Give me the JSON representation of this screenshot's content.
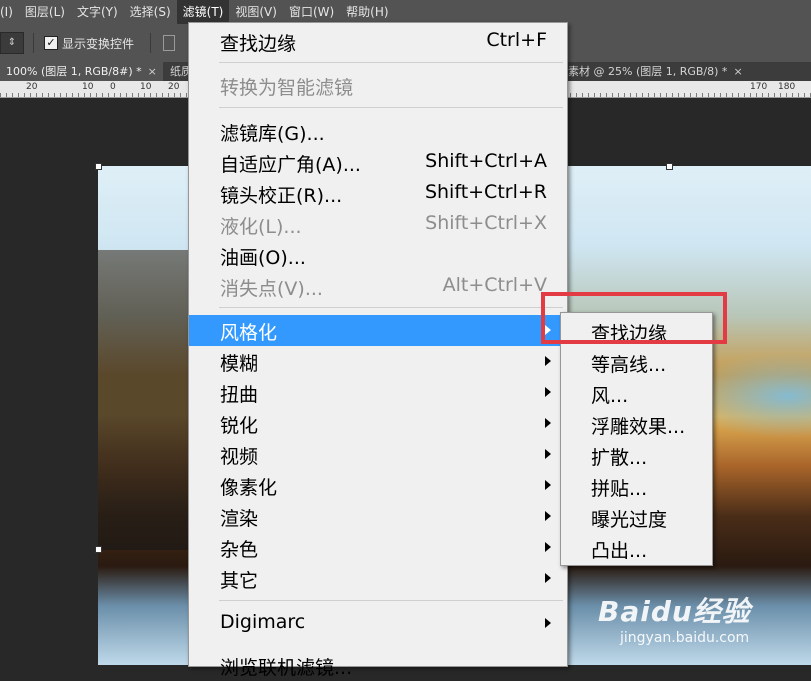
{
  "menubar": {
    "items": [
      {
        "label": "(I)"
      },
      {
        "label": "图层(L)"
      },
      {
        "label": "文字(Y)"
      },
      {
        "label": "选择(S)"
      },
      {
        "label": "滤镜(T)",
        "active": true
      },
      {
        "label": "视图(V)"
      },
      {
        "label": "窗口(W)"
      },
      {
        "label": "帮助(H)"
      }
    ]
  },
  "options_bar": {
    "show_transform_controls": {
      "label": "显示变换控件",
      "checked": true
    }
  },
  "doc_tabs": [
    {
      "label": "100% (图层 1, RGB/8#) *",
      "close": "×"
    },
    {
      "label": "纸质"
    },
    {
      "label": "素材 @ 25% (图层 1, RGB/8) *",
      "close": "×"
    }
  ],
  "ruler": {
    "labels": [
      "20",
      "10",
      "0",
      "10",
      "20",
      "170",
      "180"
    ]
  },
  "filter_menu": {
    "items": [
      {
        "label": "查找边缘",
        "shortcut": "Ctrl+F"
      },
      {
        "label": "转换为智能滤镜",
        "disabled": true
      },
      {
        "label": "滤镜库(G)..."
      },
      {
        "label": "自适应广角(A)...",
        "shortcut": "Shift+Ctrl+A"
      },
      {
        "label": "镜头校正(R)...",
        "shortcut": "Shift+Ctrl+R"
      },
      {
        "label": "液化(L)...",
        "shortcut": "Shift+Ctrl+X",
        "disabled": true
      },
      {
        "label": "油画(O)..."
      },
      {
        "label": "消失点(V)...",
        "shortcut": "Alt+Ctrl+V",
        "disabled": true
      },
      {
        "label": "风格化",
        "submenu": true,
        "highlighted": true
      },
      {
        "label": "模糊",
        "submenu": true
      },
      {
        "label": "扭曲",
        "submenu": true
      },
      {
        "label": "锐化",
        "submenu": true
      },
      {
        "label": "视频",
        "submenu": true
      },
      {
        "label": "像素化",
        "submenu": true
      },
      {
        "label": "渲染",
        "submenu": true
      },
      {
        "label": "杂色",
        "submenu": true
      },
      {
        "label": "其它",
        "submenu": true
      },
      {
        "label": "Digimarc",
        "submenu": true
      },
      {
        "label": "浏览联机滤镜..."
      }
    ]
  },
  "stylize_submenu": {
    "items": [
      {
        "label": "查找边缘"
      },
      {
        "label": "等高线..."
      },
      {
        "label": "风..."
      },
      {
        "label": "浮雕效果..."
      },
      {
        "label": "扩散..."
      },
      {
        "label": "拼贴..."
      },
      {
        "label": "曝光过度"
      },
      {
        "label": "凸出..."
      }
    ]
  },
  "watermark": {
    "logo": "Baidu经验",
    "site": "jingyan.baidu.com"
  },
  "colors": {
    "highlight": "#3399ff",
    "annotation": "#e23b44"
  }
}
